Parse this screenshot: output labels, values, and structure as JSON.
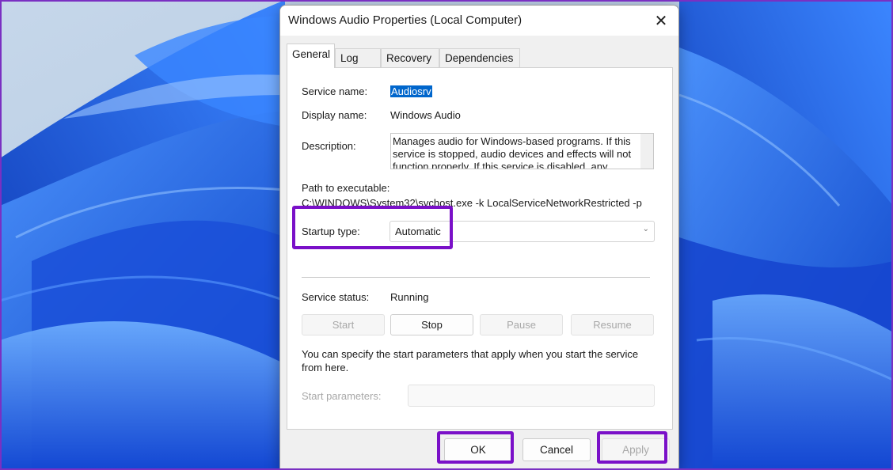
{
  "window": {
    "title": "Windows Audio Properties (Local Computer)",
    "close_glyph": "✕"
  },
  "tabs": [
    {
      "label": "General",
      "active": true
    },
    {
      "label": "Log On",
      "active": false
    },
    {
      "label": "Recovery",
      "active": false
    },
    {
      "label": "Dependencies",
      "active": false
    }
  ],
  "general": {
    "service_name_label": "Service name:",
    "service_name_value": "Audiosrv",
    "display_name_label": "Display name:",
    "display_name_value": "Windows Audio",
    "description_label": "Description:",
    "description_value": "Manages audio for Windows-based programs.  If this service is stopped, audio devices and effects will not function properly.  If this service is disabled, any",
    "path_label": "Path to executable:",
    "path_value": "C:\\WINDOWS\\System32\\svchost.exe -k LocalServiceNetworkRestricted -p",
    "startup_type_label": "Startup type:",
    "startup_type_value": "Automatic",
    "service_status_label": "Service status:",
    "service_status_value": "Running",
    "buttons": {
      "start": "Start",
      "stop": "Stop",
      "pause": "Pause",
      "resume": "Resume"
    },
    "hint_line1": "You can specify the start parameters that apply when you start the service",
    "hint_line2": "from here.",
    "start_params_label": "Start parameters:",
    "start_params_value": ""
  },
  "footer": {
    "ok": "OK",
    "cancel": "Cancel",
    "apply": "Apply"
  },
  "colors": {
    "highlight": "#7a10c8",
    "selection": "#0066cc",
    "wallpaper_blue": "#1e5fe0"
  }
}
